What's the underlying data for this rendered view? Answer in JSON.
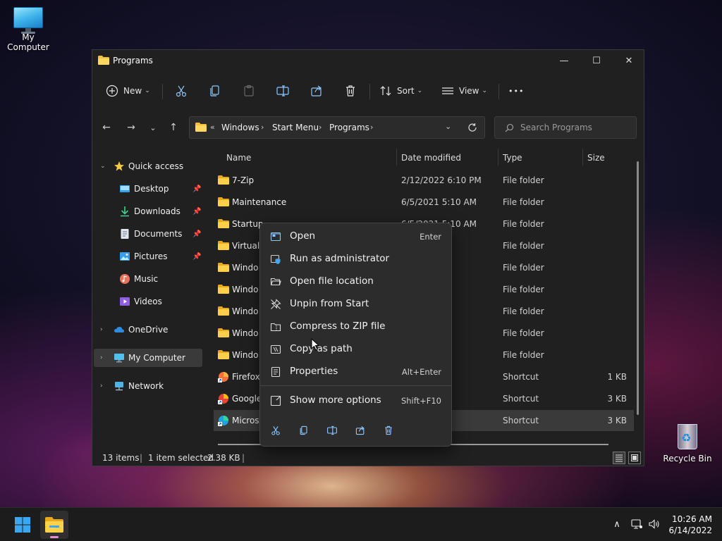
{
  "desktop": {
    "my_computer_label": "My Computer",
    "recycle_bin_label": "Recycle Bin"
  },
  "window": {
    "title": "Programs",
    "controls": {
      "minimize": "—",
      "maximize": "☐",
      "close": "✕"
    }
  },
  "toolbar": {
    "new_label": "New",
    "sort_label": "Sort",
    "view_label": "View",
    "more_label": "•••"
  },
  "address": {
    "prefix": "«",
    "crumbs": [
      "Windows",
      "Start Menu",
      "Programs"
    ],
    "separator": "›",
    "search_placeholder": "Search Programs"
  },
  "sidebar": {
    "items": [
      {
        "label": "Quick access",
        "icon": "star-icon"
      },
      {
        "label": "Desktop",
        "icon": "desktop-icon"
      },
      {
        "label": "Downloads",
        "icon": "download-icon"
      },
      {
        "label": "Documents",
        "icon": "document-icon"
      },
      {
        "label": "Pictures",
        "icon": "picture-icon"
      },
      {
        "label": "Music",
        "icon": "music-icon"
      },
      {
        "label": "Videos",
        "icon": "video-icon"
      },
      {
        "label": "OneDrive",
        "icon": "cloud-icon"
      },
      {
        "label": "My Computer",
        "icon": "computer-icon"
      },
      {
        "label": "Network",
        "icon": "network-icon"
      }
    ],
    "expand_icon": "⌄",
    "collapsed_icon": "›",
    "pin_glyph": "📌"
  },
  "columns": {
    "name": "Name",
    "date": "Date modified",
    "type": "Type",
    "size": "Size"
  },
  "files": [
    {
      "name": "7-Zip",
      "date": "2/12/2022 6:10 PM",
      "type": "File folder",
      "size": ""
    },
    {
      "name": "Maintenance",
      "date": "6/5/2021 5:10 AM",
      "type": "File folder",
      "size": ""
    },
    {
      "name": "Startup",
      "date": "6/5/2021 5:10 AM",
      "type": "File folder",
      "size": ""
    },
    {
      "name": "Virtual A",
      "date": "P M",
      "type": "File folder",
      "size": ""
    },
    {
      "name": "Windo",
      "date": "2 PM",
      "type": "File folder",
      "size": ""
    },
    {
      "name": "Windo",
      "date": "AM",
      "type": "File folder",
      "size": ""
    },
    {
      "name": "Windo",
      "date": "AM",
      "type": "File folder",
      "size": ""
    },
    {
      "name": "Windo",
      "date": "PM",
      "type": "File folder",
      "size": ""
    },
    {
      "name": "Windo",
      "date": "PM",
      "type": "File folder",
      "size": ""
    },
    {
      "name": "Firefox",
      "date": "PM",
      "type": "Shortcut",
      "size": "1 KB"
    },
    {
      "name": "Google",
      "date": "7 PM",
      "type": "Shortcut",
      "size": "3 KB"
    },
    {
      "name": "Microso",
      "date": "35 PM",
      "type": "Shortcut",
      "size": "3 KB"
    }
  ],
  "status": {
    "items": "13 items",
    "selection": "1 item selected",
    "size": "2.38 KB",
    "sep": "|"
  },
  "context_menu": {
    "items": [
      {
        "label": "Open",
        "shortcut": "Enter"
      },
      {
        "label": "Run as administrator",
        "shortcut": ""
      },
      {
        "label": "Open file location",
        "shortcut": ""
      },
      {
        "label": "Unpin from Start",
        "shortcut": ""
      },
      {
        "label": "Compress to ZIP file",
        "shortcut": ""
      },
      {
        "label": "Copy as path",
        "shortcut": ""
      },
      {
        "label": "Properties",
        "shortcut": "Alt+Enter"
      }
    ],
    "more": {
      "label": "Show more options",
      "shortcut": "Shift+F10"
    }
  },
  "taskbar": {
    "time": "10:26 AM",
    "date": "6/14/2022",
    "chevron": "∧"
  },
  "colors": {
    "accent": "#4cc2ff",
    "folder": "#f3c13a",
    "window_bg": "#202020",
    "menu_bg": "#2c2c2c"
  }
}
